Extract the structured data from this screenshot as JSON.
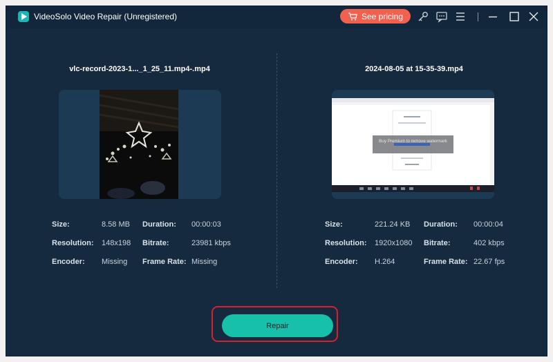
{
  "app": {
    "title": "VideoSolo Video Repair (Unregistered)"
  },
  "toolbar": {
    "pricing_label": "See pricing",
    "icons": [
      "key-icon",
      "feedback-icon",
      "menu-icon",
      "minimize-icon",
      "maximize-icon",
      "close-icon"
    ]
  },
  "left": {
    "file_name": "vlc-record-2023-1..._1_25_11.mp4-.mp4",
    "labels": {
      "size": "Size:",
      "duration": "Duration:",
      "resolution": "Resolution:",
      "bitrate": "Bitrate:",
      "encoder": "Encoder:",
      "frame_rate": "Frame Rate:"
    },
    "values": {
      "size": "8.58 MB",
      "duration": "00:00:03",
      "resolution": "148x198",
      "bitrate": "23981 kbps",
      "encoder": "Missing",
      "frame_rate": "Missing"
    }
  },
  "right": {
    "file_name": "2024-08-05 at 15-35-39.mp4",
    "watermark_text": "Buy Premium to remove watermark",
    "labels": {
      "size": "Size:",
      "duration": "Duration:",
      "resolution": "Resolution:",
      "bitrate": "Bitrate:",
      "encoder": "Encoder:",
      "frame_rate": "Frame Rate:"
    },
    "values": {
      "size": "221.24 KB",
      "duration": "00:00:04",
      "resolution": "1920x1080",
      "bitrate": "402 kbps",
      "encoder": "H.264",
      "frame_rate": "22.67 fps"
    }
  },
  "actions": {
    "repair_label": "Repair"
  },
  "colors": {
    "background": "#152a3e",
    "accent": "#17c0a8",
    "pricing": "#f0614f",
    "highlight": "#d9212d"
  }
}
